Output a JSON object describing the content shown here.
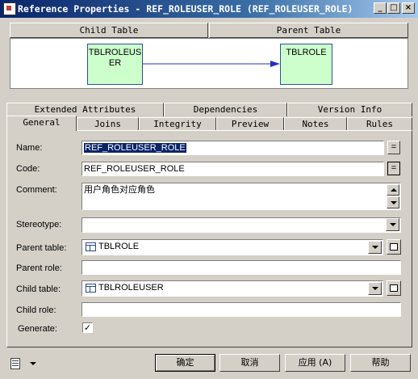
{
  "window": {
    "title": "Reference Properties - REF_ROLEUSER_ROLE (REF_ROLEUSER_ROLE)",
    "min_glyph": "_",
    "max_glyph": "□",
    "close_glyph": "×"
  },
  "diagram": {
    "child_header": "Child Table",
    "parent_header": "Parent Table",
    "child_table_line1": "TBLROLEUS",
    "child_table_line2": "ER",
    "parent_table": "TBLROLE"
  },
  "tabs_back": [
    "Extended Attributes",
    "Dependencies",
    "Version Info"
  ],
  "tabs_front": [
    "General",
    "Joins",
    "Integrity",
    "Preview",
    "Notes",
    "Rules"
  ],
  "active_tab": "General",
  "form": {
    "name_label": "Name:",
    "name_value": "REF_ROLEUSER_ROLE",
    "code_label": "Code:",
    "code_value": "REF_ROLEUSER_ROLE",
    "eq_glyph": "=",
    "comment_label": "Comment:",
    "comment_value": "用户角色对应角色",
    "stereotype_label": "Stereotype:",
    "stereotype_value": "",
    "parent_table_label": "Parent table:",
    "parent_table_value": "TBLROLE",
    "parent_role_label": "Parent role:",
    "parent_role_value": "",
    "child_table_label": "Child table:",
    "child_table_value": "TBLROLEUSER",
    "child_role_label": "Child role:",
    "child_role_value": "",
    "generate_label": "Generate:",
    "generate_checked": true,
    "check_glyph": "✓"
  },
  "buttons": {
    "ok": "确定",
    "cancel": "取消",
    "apply": "应用 (A)",
    "help": "帮助"
  },
  "colors": {
    "titlebar": "#0a246a",
    "table_fill": "#ccffcc",
    "link_arrow": "#2030c0"
  }
}
